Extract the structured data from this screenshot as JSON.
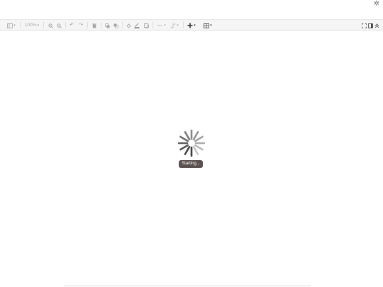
{
  "toolbar": {
    "zoom_value": "100%",
    "icons": [
      "view-icon",
      "zoom-in-icon",
      "zoom-out-icon",
      "undo-icon",
      "redo-icon",
      "delete-icon",
      "to-front-icon",
      "to-back-icon",
      "fill-color-icon",
      "line-color-icon",
      "shadow-icon",
      "connection-icon",
      "waypoints-icon",
      "insert-icon",
      "table-icon",
      "fullscreen-icon",
      "format-panel-icon",
      "collapse-icon"
    ]
  },
  "status": {
    "text": "Starting..."
  }
}
